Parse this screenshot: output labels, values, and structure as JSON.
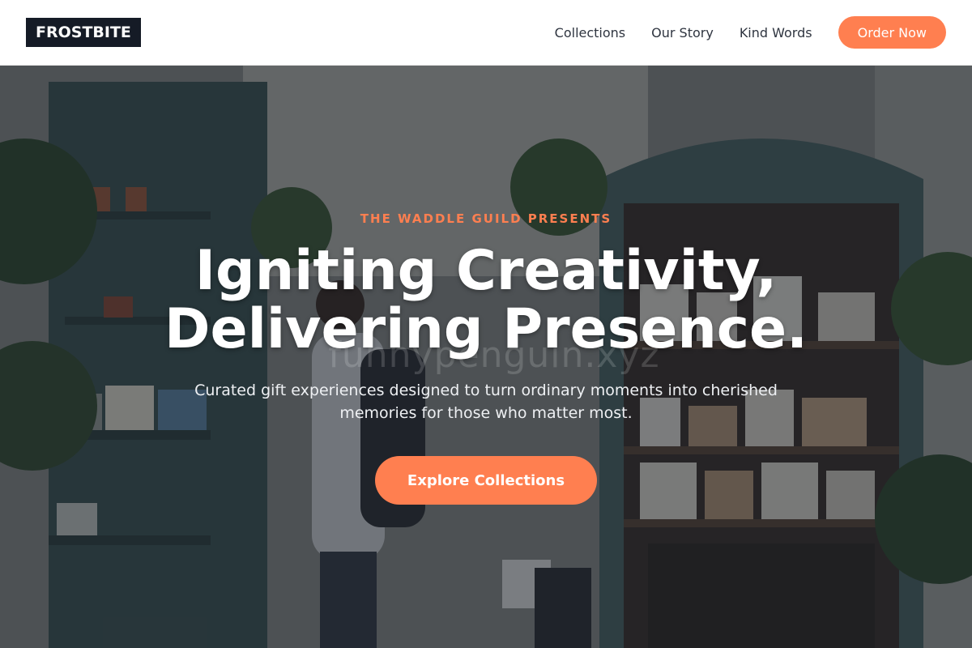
{
  "header": {
    "brand": "FROSTBITE",
    "nav": [
      "Collections",
      "Our Story",
      "Kind Words"
    ],
    "order_label": "Order Now"
  },
  "hero": {
    "background_image": "gift-shop-interior-photo",
    "watermark": "funnypenguin.xyz",
    "eyebrow": "THE WADDLE GUILD PRESENTS",
    "headline_line1": "Igniting Creativity,",
    "headline_line2": "Delivering Presence.",
    "subtext": "Curated gift experiences designed to turn ordinary moments into cherished memories for those who matter most.",
    "cta_label": "Explore Collections"
  },
  "colors": {
    "accent": "#ff7f50",
    "brand_bg": "#151b26",
    "header_bg": "#ffffff",
    "headline": "#ffffff"
  }
}
